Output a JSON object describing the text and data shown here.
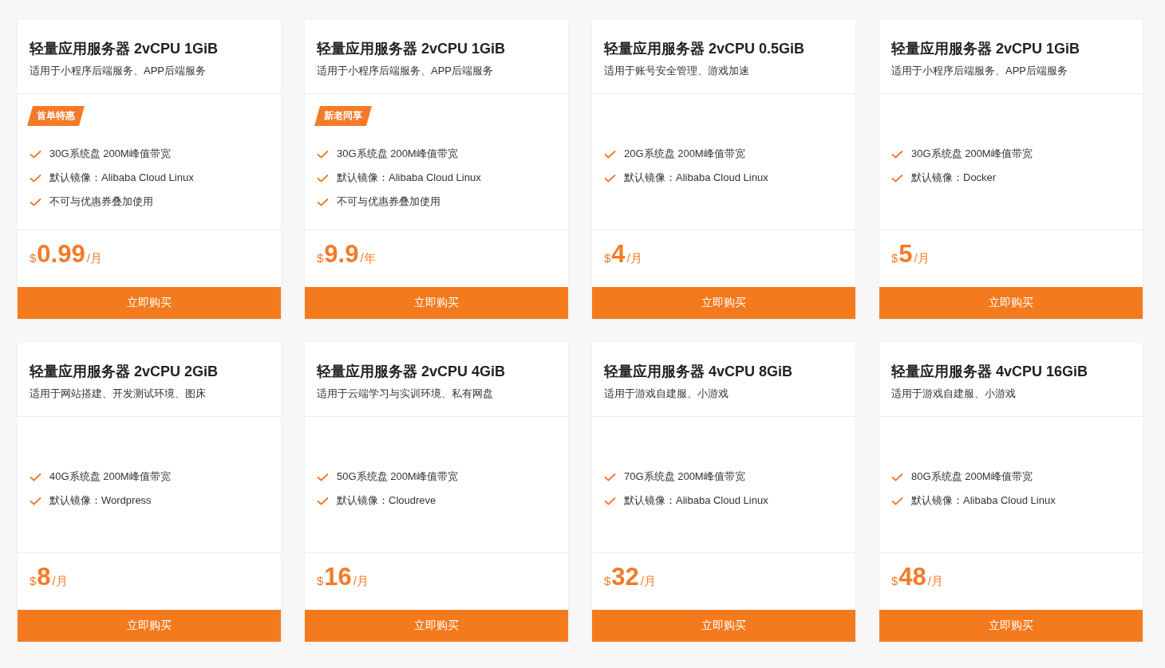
{
  "cards": [
    {
      "title": "轻量应用服务器 2vCPU 1GiB",
      "subtitle": "适用于小程序后端服务、APP后端服务",
      "badge": "首单特惠",
      "features": [
        "30G系统盘 200M峰值带宽",
        "默认镜像：Alibaba Cloud Linux",
        "不可与优惠券叠加使用"
      ],
      "currency": "$",
      "price": "0.99",
      "unit": "/月",
      "button": "立即购买"
    },
    {
      "title": "轻量应用服务器 2vCPU 1GiB",
      "subtitle": "适用于小程序后端服务、APP后端服务",
      "badge": "新老同享",
      "features": [
        "30G系统盘 200M峰值带宽",
        "默认镜像：Alibaba Cloud Linux",
        "不可与优惠券叠加使用"
      ],
      "currency": "$",
      "price": "9.9",
      "unit": "/年",
      "button": "立即购买"
    },
    {
      "title": "轻量应用服务器 2vCPU 0.5GiB",
      "subtitle": "适用于账号安全管理、游戏加速",
      "features": [
        "20G系统盘 200M峰值带宽",
        "默认镜像：Alibaba Cloud Linux"
      ],
      "currency": "$",
      "price": "4",
      "unit": "/月",
      "button": "立即购买"
    },
    {
      "title": "轻量应用服务器 2vCPU 1GiB",
      "subtitle": "适用于小程序后端服务、APP后端服务",
      "features": [
        "30G系统盘 200M峰值带宽",
        "默认镜像：Docker"
      ],
      "currency": "$",
      "price": "5",
      "unit": "/月",
      "button": "立即购买"
    },
    {
      "title": "轻量应用服务器 2vCPU 2GiB",
      "subtitle": "适用于网站搭建、开发测试环境、图床",
      "features": [
        "40G系统盘 200M峰值带宽",
        "默认镜像：Wordpress"
      ],
      "currency": "$",
      "price": "8",
      "unit": "/月",
      "button": "立即购买"
    },
    {
      "title": "轻量应用服务器 2vCPU 4GiB",
      "subtitle": "适用于云端学习与实训环境、私有网盘",
      "features": [
        "50G系统盘 200M峰值带宽",
        "默认镜像：Cloudreve"
      ],
      "currency": "$",
      "price": "16",
      "unit": "/月",
      "button": "立即购买"
    },
    {
      "title": "轻量应用服务器 4vCPU 8GiB",
      "subtitle": "适用于游戏自建服、小游戏",
      "features": [
        "70G系统盘 200M峰值带宽",
        "默认镜像：Alibaba Cloud Linux"
      ],
      "currency": "$",
      "price": "32",
      "unit": "/月",
      "button": "立即购买"
    },
    {
      "title": "轻量应用服务器 4vCPU 16GiB",
      "subtitle": "适用于游戏自建服、小游戏",
      "features": [
        "80G系统盘 200M峰值带宽",
        "默认镜像：Alibaba Cloud Linux"
      ],
      "currency": "$",
      "price": "48",
      "unit": "/月",
      "button": "立即购买"
    }
  ]
}
